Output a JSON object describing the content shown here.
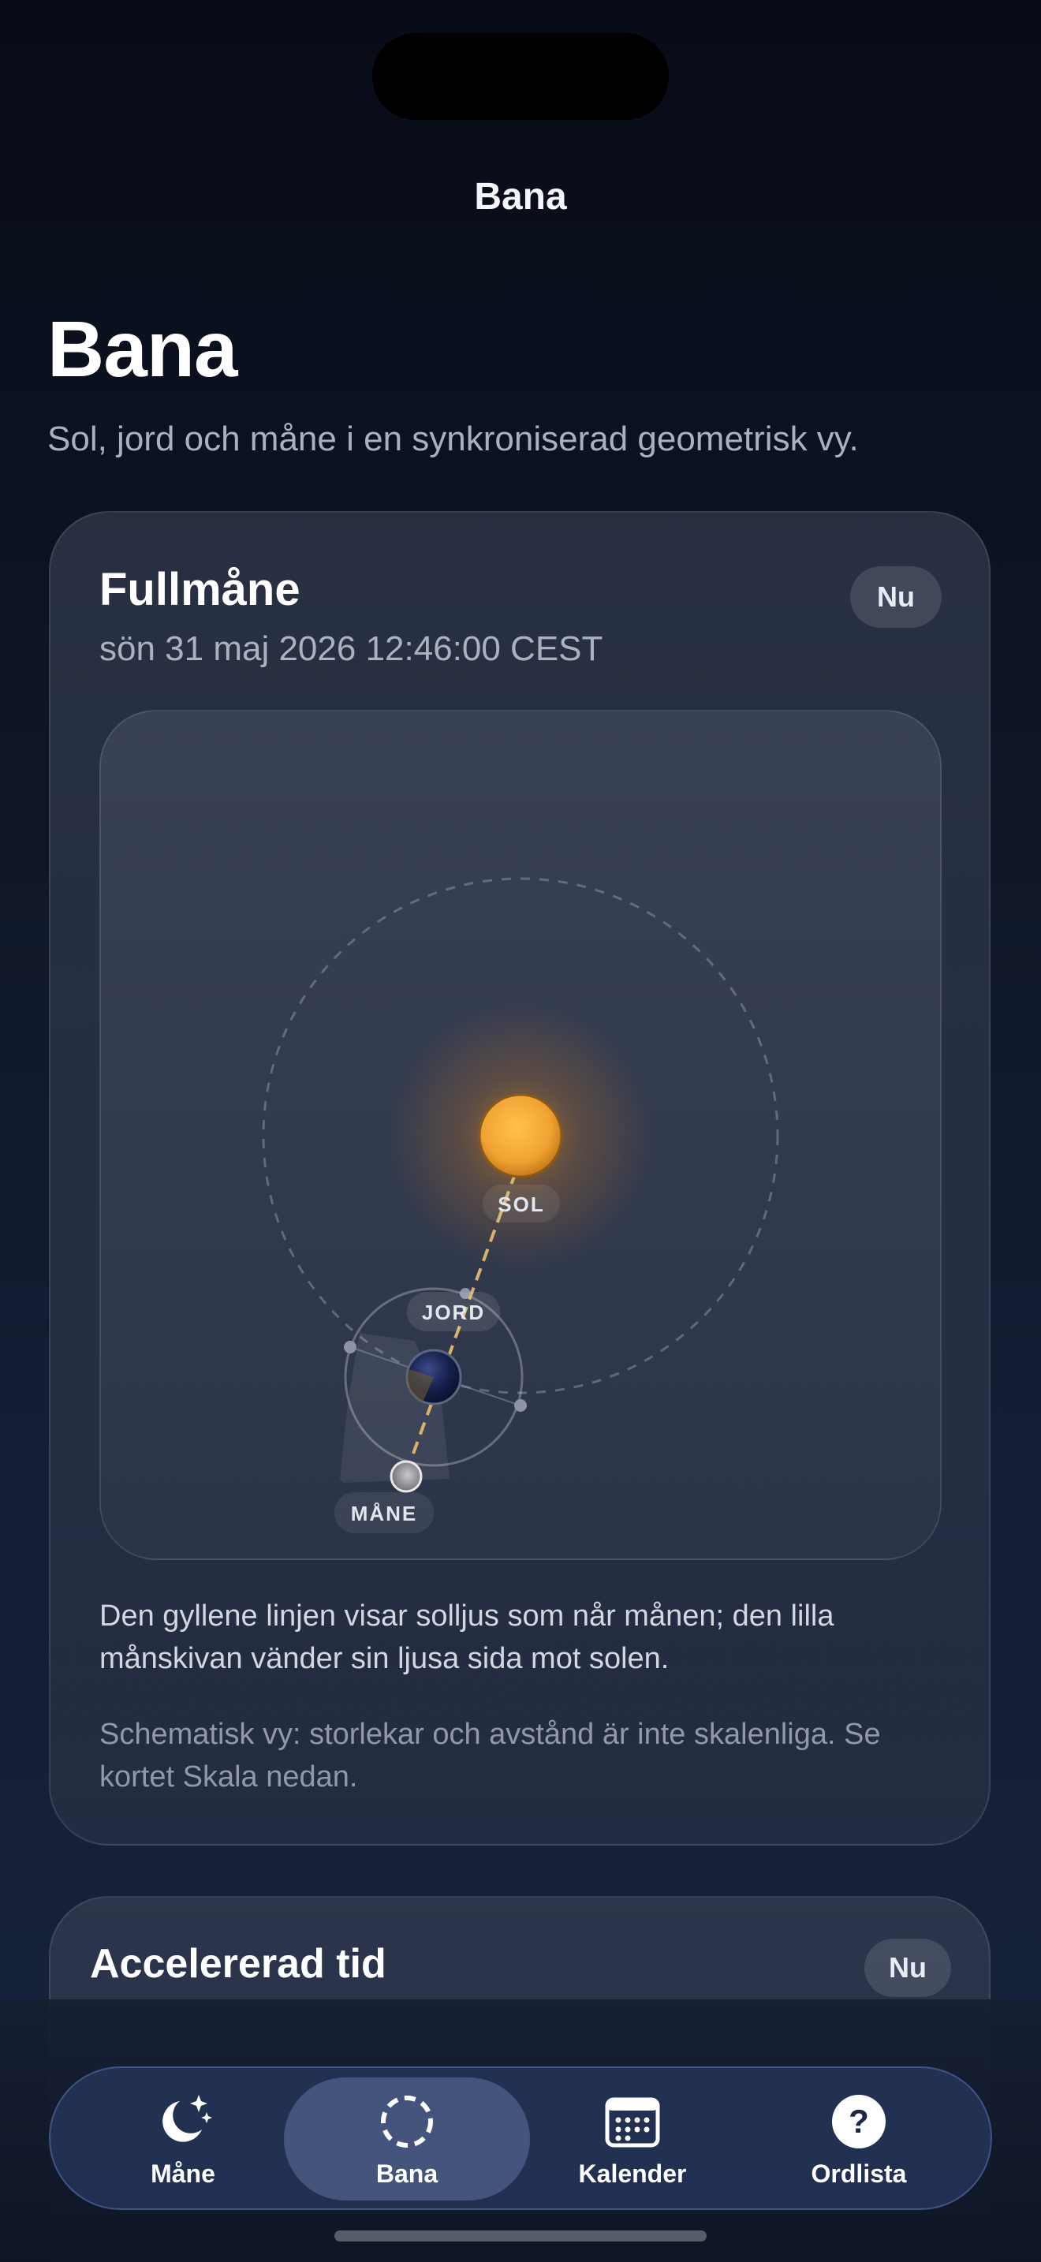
{
  "nav": {
    "title": "Bana"
  },
  "header": {
    "title": "Bana",
    "subtitle": "Sol, jord och måne i en synkroniserad geometrisk vy."
  },
  "orbit_card": {
    "title": "Fullmåne",
    "datetime": "sön 31 maj 2026 12:46:00 CEST",
    "now_label": "Nu",
    "labels": {
      "sun": "SOL",
      "earth": "JORD",
      "moon": "MÅNE"
    },
    "description": "Den gyllene linjen visar solljus som når månen; den lilla månskivan vänder sin ljusa sida mot solen.",
    "note": "Schematisk vy: storlekar och avstånd är inte skalenliga. Se kortet Skala nedan."
  },
  "accelerated_card": {
    "title": "Accelererad tid",
    "now_label": "Nu"
  },
  "tabbar": {
    "active": "Bana",
    "tabs": [
      {
        "label": "Måne",
        "icon": "moon-stars-icon"
      },
      {
        "label": "Bana",
        "icon": "dashed-circle-icon"
      },
      {
        "label": "Kalender",
        "icon": "calendar-icon"
      },
      {
        "label": "Ordlista",
        "icon": "question-icon"
      }
    ]
  },
  "colors": {
    "background": "#0d1322",
    "sun": "#f2a83a",
    "sunlight_line": "#d9b36b",
    "tab_active": "#7d8cbd"
  }
}
